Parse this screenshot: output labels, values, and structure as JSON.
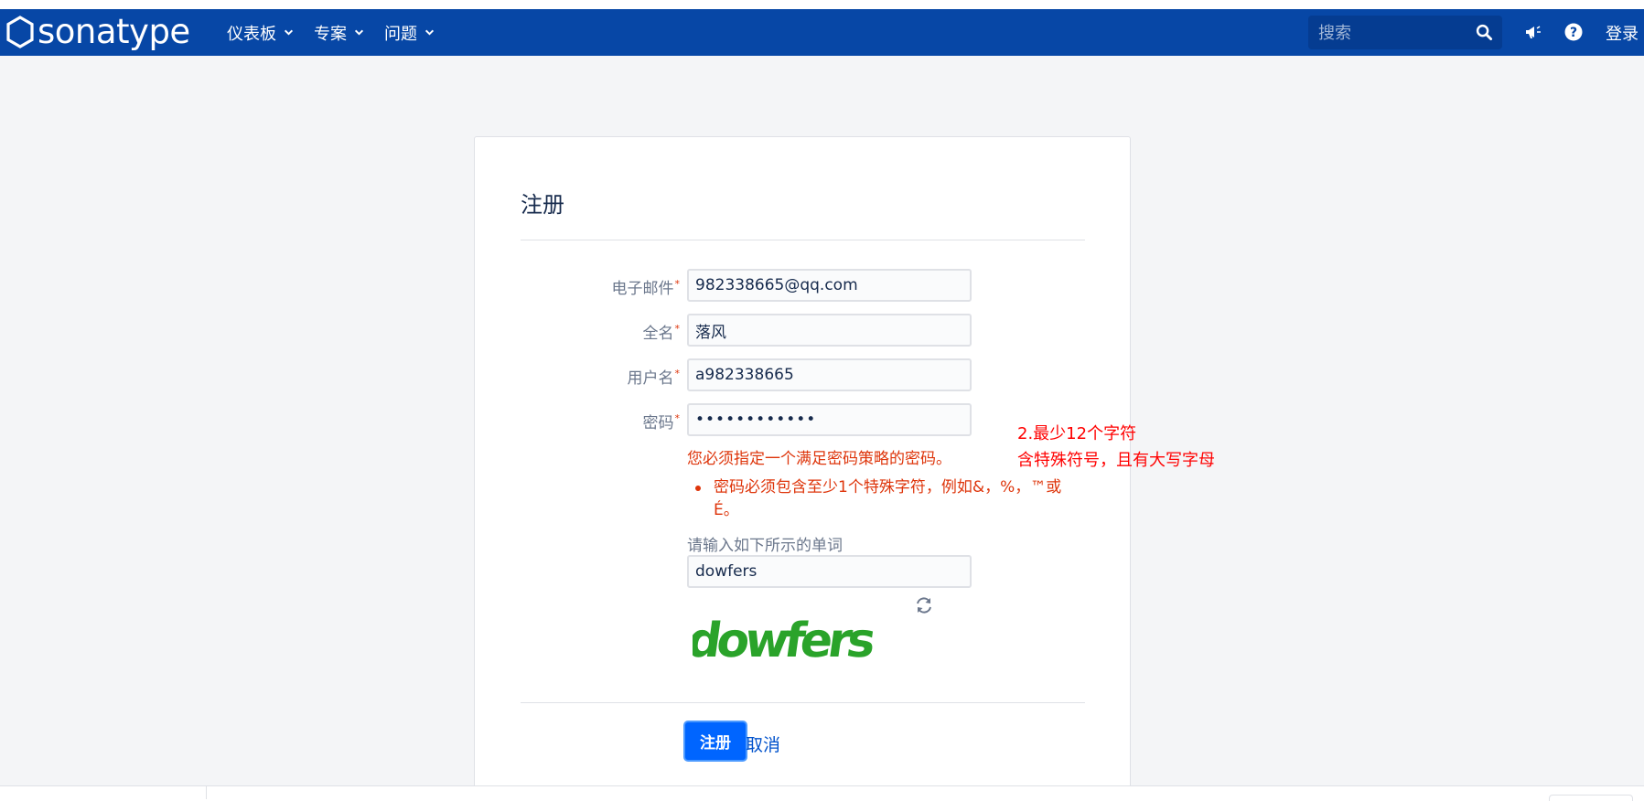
{
  "header": {
    "brand": "sonatype",
    "nav": [
      {
        "label": "仪表板"
      },
      {
        "label": "专案"
      },
      {
        "label": "问题"
      }
    ],
    "search_placeholder": "搜索",
    "login_label": "登录"
  },
  "form": {
    "title": "注册",
    "required_mark": "*",
    "fields": {
      "email": {
        "label": "电子邮件",
        "value": "982338665@qq.com"
      },
      "fullname": {
        "label": "全名",
        "value": "落风"
      },
      "username": {
        "label": "用户名",
        "value": "a982338665"
      },
      "password": {
        "label": "密码",
        "value": "••••••••••••"
      }
    },
    "error_main": "您必须指定一个满足密码策略的密码。",
    "error_items": [
      "密码必须包含至少1个特殊字符，例如&，%，™或É。"
    ],
    "captcha": {
      "label": "请输入如下所示的单词",
      "value": "dowfers",
      "image_text": "dowfers"
    },
    "submit_label": "注册",
    "cancel_label": "取消"
  },
  "annotation": {
    "line1": "2.最少12个字符",
    "line2": "含特殊符号，且有大写字母"
  },
  "colors": {
    "header_bg": "#0747a6",
    "error": "#de350b",
    "annotation": "#ff0000",
    "primary_button": "#0065ff",
    "captcha_green": "#2aa32a"
  }
}
